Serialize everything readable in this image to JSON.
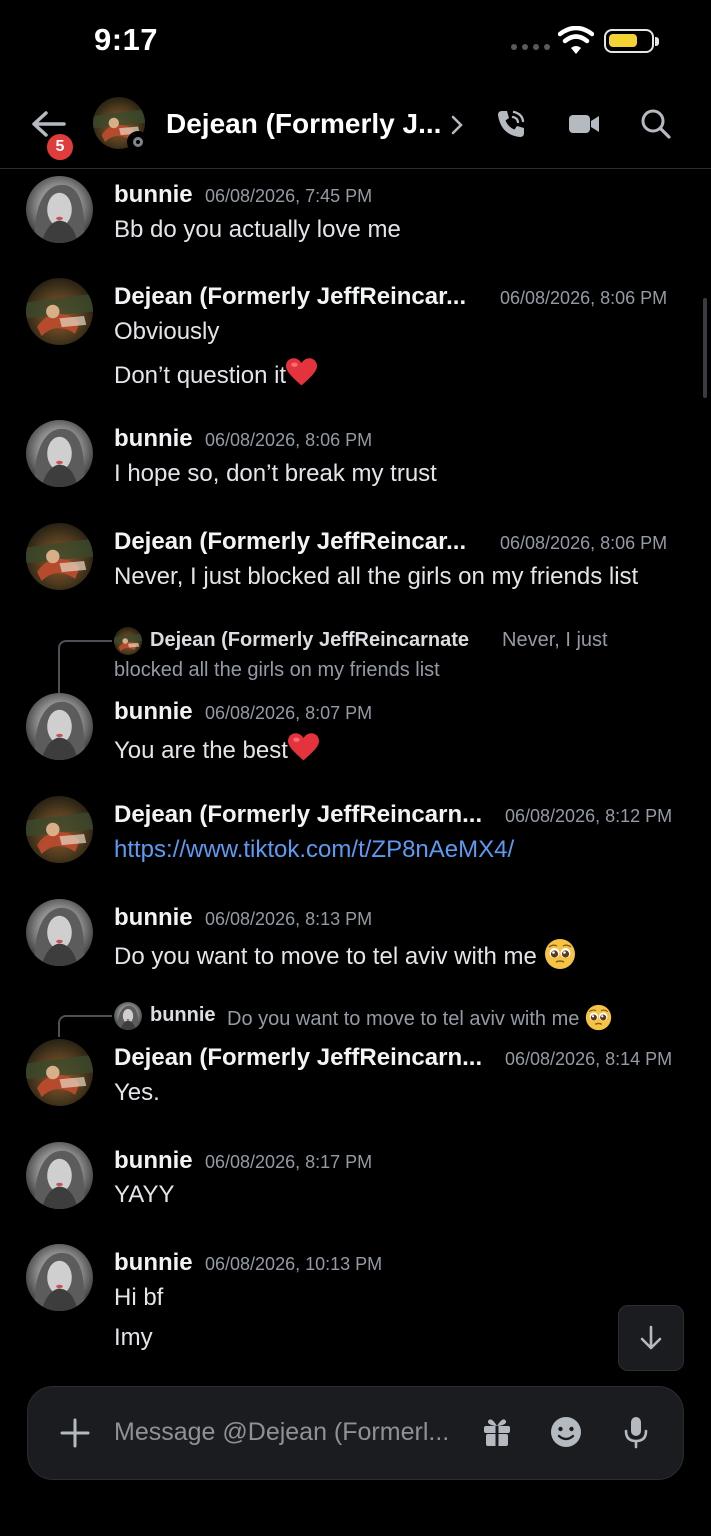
{
  "status_bar": {
    "time": "9:17"
  },
  "header": {
    "back_badge": "5",
    "title": "Dejean (Formerly J...",
    "icons": [
      "phone-icon",
      "video-icon",
      "search-icon"
    ]
  },
  "messages": [
    {
      "author": "bunnie",
      "timestamp": "06/08/2026, 7:45 PM",
      "lines": [
        "Bb do you actually love me"
      ]
    },
    {
      "author": "Dejean (Formerly JeffReincar...",
      "timestamp": "06/08/2026, 8:06 PM",
      "lines": [
        "Obviously",
        "Don’t question it"
      ]
    },
    {
      "author": "bunnie",
      "timestamp": "06/08/2026, 8:06 PM",
      "lines": [
        "I hope so, don’t break my trust"
      ]
    },
    {
      "author": "Dejean (Formerly JeffReincar...",
      "timestamp": "06/08/2026, 8:06 PM",
      "lines": [
        "Never, I just blocked all the girls on my friends list"
      ]
    },
    {
      "reply_author": "Dejean (Formerly JeffReincarnate",
      "reply_text_1": "Never, I just",
      "reply_text_2": "blocked all the girls on my friends list",
      "author": "bunnie",
      "timestamp": "06/08/2026, 8:07 PM",
      "lines": [
        "You are the best"
      ]
    },
    {
      "author": "Dejean (Formerly JeffReincarn...",
      "timestamp": "06/08/2026, 8:12 PM",
      "lines": [
        "https://www.tiktok.com/t/ZP8nAeMX4/"
      ]
    },
    {
      "author": "bunnie",
      "timestamp": "06/08/2026, 8:13 PM",
      "lines": [
        "Do you want to move to tel aviv with me"
      ]
    },
    {
      "reply_author": "bunnie",
      "reply_text_1": "Do you want to move to tel aviv with me",
      "author": "Dejean (Formerly JeffReincarn...",
      "timestamp": "06/08/2026, 8:14 PM",
      "lines": [
        "Yes."
      ]
    },
    {
      "author": "bunnie",
      "timestamp": "06/08/2026, 8:17 PM",
      "lines": [
        "YAYY"
      ]
    },
    {
      "author": "bunnie",
      "timestamp": "06/08/2026, 10:13 PM",
      "lines": [
        "Hi bf",
        "Imy"
      ]
    }
  ],
  "composer": {
    "placeholder": "Message @Dejean (Formerl..."
  },
  "colors": {
    "background": "#000000",
    "link": "#5b9cf2",
    "badge": "#e03c3c",
    "battery": "#f4d233"
  }
}
